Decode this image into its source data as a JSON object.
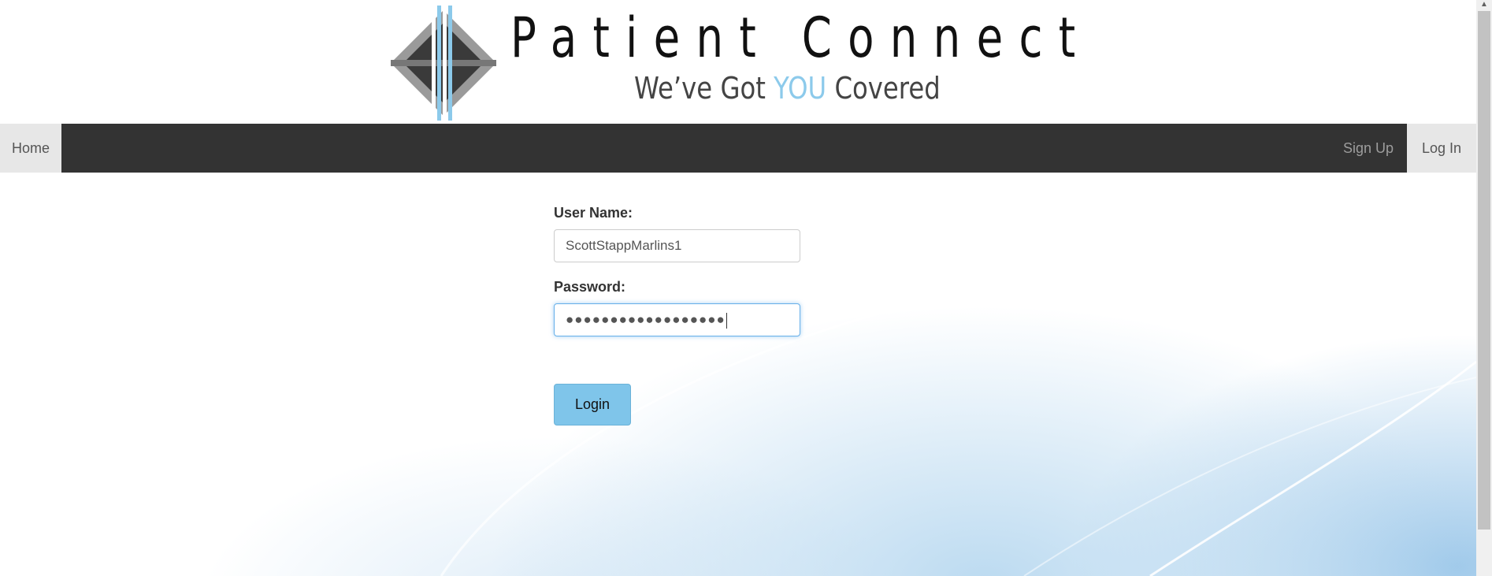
{
  "brand": {
    "name": "Patient Connect",
    "tagline_start": "We’ve Got ",
    "tagline_accent": "YOU",
    "tagline_end": " Covered",
    "accent_color": "#8ccaeb"
  },
  "nav": {
    "home": "Home",
    "sign_up": "Sign Up",
    "log_in": "Log In"
  },
  "form": {
    "username_label": "User Name:",
    "username_value": "ScottStappMarlins1",
    "password_label": "Password:",
    "password_masked": "●●●●●●●●●●●●●●●●●●",
    "login_button": "Login"
  },
  "icons": {
    "scroll_up": "scroll-up-arrow-icon"
  }
}
